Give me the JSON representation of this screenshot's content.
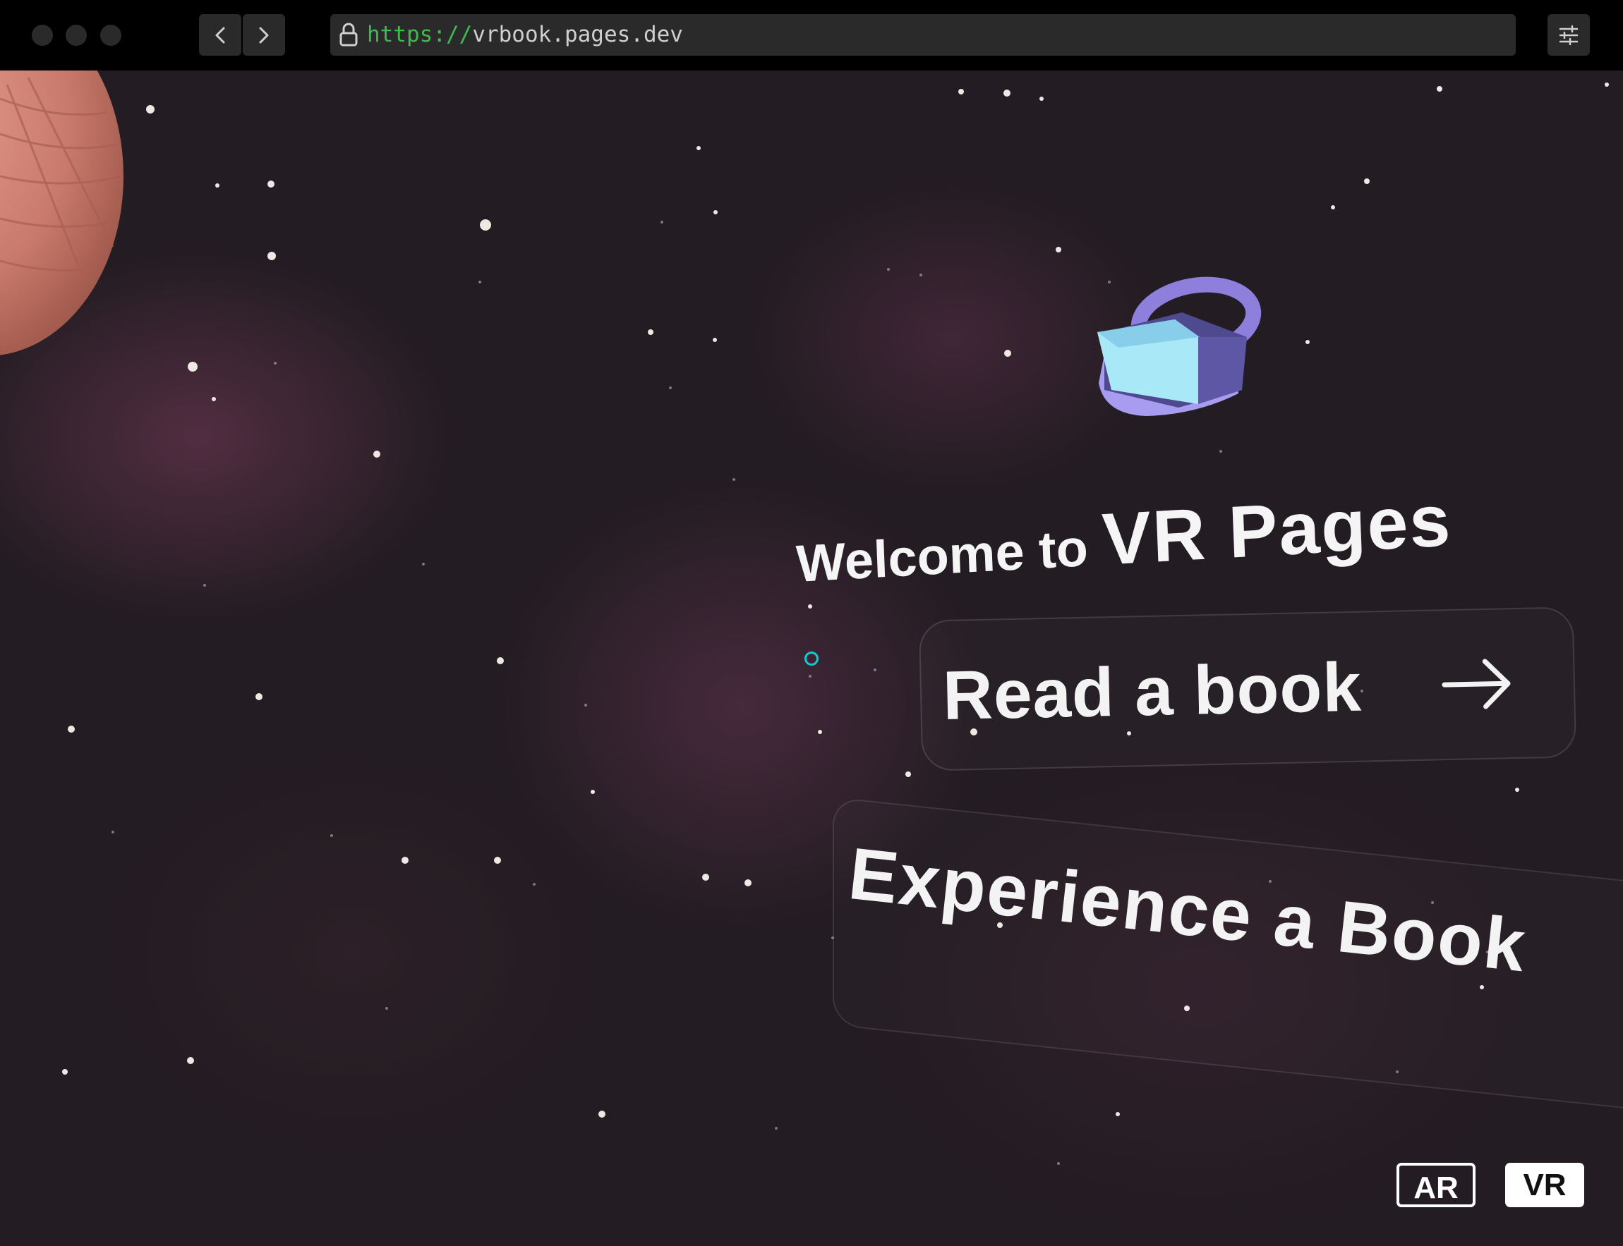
{
  "browser": {
    "url_scheme": "https://",
    "url_host": "vrbook.pages.dev",
    "icons": [
      "window-dot-icon",
      "back-arrow-icon",
      "forward-arrow-icon",
      "lock-icon",
      "settings-sliders-icon"
    ]
  },
  "scene": {
    "welcome_prefix": "Welcome to",
    "welcome_brand": "VR Pages",
    "read_book_label": "Read a book",
    "experience_label": "Experience a Book",
    "icons": [
      "planet-icon",
      "vr-headset-icon",
      "arrow-right-icon",
      "gaze-cursor-icon"
    ]
  },
  "modes": {
    "ar_label": "AR",
    "vr_label": "VR"
  },
  "colors": {
    "background": "#231c22",
    "accent_url_scheme": "#3fb950",
    "cursor": "#19c8d2",
    "text": "#f5f5f5"
  }
}
